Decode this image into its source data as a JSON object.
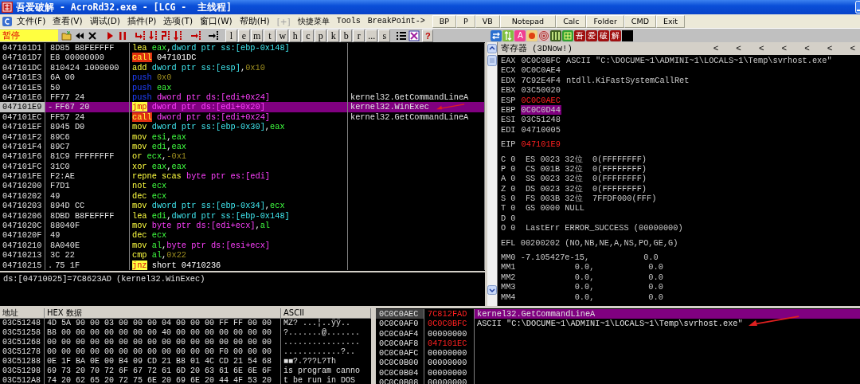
{
  "window": {
    "title": "吾爱破解 - AcroRd32.exe - [LCG -  主线程]"
  },
  "menu": {
    "items": [
      {
        "label": "文件(F)",
        "disabled": false
      },
      {
        "label": "查看(V)",
        "disabled": false
      },
      {
        "label": "调试(D)",
        "disabled": false
      },
      {
        "label": "插件(P)",
        "disabled": false
      },
      {
        "label": "选项(T)",
        "disabled": false
      },
      {
        "label": "窗口(W)",
        "disabled": false
      },
      {
        "label": "帮助(H)",
        "disabled": false
      },
      {
        "label": "[+]",
        "disabled": true
      },
      {
        "label": "快捷菜单",
        "disabled": false
      },
      {
        "label": "Tools",
        "disabled": false
      },
      {
        "label": "BreakPoint->",
        "disabled": false
      }
    ],
    "quick_buttons": [
      "BP",
      "P",
      "VB",
      "Notepad",
      "Calc",
      "Folder",
      "CMD",
      "Exit"
    ]
  },
  "toolbar": {
    "status": "暂停",
    "letter_buttons": [
      "l",
      "e",
      "m",
      "t",
      "w",
      "h",
      "c",
      "p",
      "k",
      "b",
      "r",
      "...",
      "s"
    ],
    "help_button": "?",
    "plugin_tools": [
      {
        "kind": "swap"
      },
      {
        "kind": "updown"
      },
      {
        "kind": "letter",
        "label": "A",
        "color": "#f04090"
      },
      {
        "kind": "record"
      },
      {
        "kind": "target"
      },
      {
        "kind": "bars"
      },
      {
        "kind": "window"
      },
      {
        "kind": "letter",
        "label": "吾",
        "color": "#a01010"
      },
      {
        "kind": "letter",
        "label": "爱",
        "color": "#a01010"
      },
      {
        "kind": "letter",
        "label": "破",
        "color": "#a01010"
      },
      {
        "kind": "letter",
        "label": "解",
        "color": "#a01010"
      },
      {
        "kind": "black"
      }
    ]
  },
  "disassembly": {
    "rows": [
      {
        "address": "047101D1",
        "marker": "",
        "hex": "8D85 B8FEFFFF",
        "mnemonic": "lea",
        "kind": "op",
        "ops": [
          {
            "kind": "reg",
            "text": "eax"
          },
          {
            "kind": "sep",
            "text": ","
          },
          {
            "kind": "stack",
            "text": "dword ptr ss:[ebp-0x148]"
          }
        ],
        "comment": "",
        "selected": false
      },
      {
        "address": "047101D7",
        "marker": "",
        "hex": "E8 00000000",
        "mnemonic": "call",
        "kind": "call",
        "ops": [
          {
            "kind": "plain",
            "text": "047101DC"
          }
        ],
        "comment": "",
        "selected": false
      },
      {
        "address": "047101DC",
        "marker": "",
        "hex": "810424 1000000",
        "mnemonic": "add",
        "kind": "op",
        "ops": [
          {
            "kind": "stack",
            "text": "dword ptr ss:[esp]"
          },
          {
            "kind": "sep",
            "text": ","
          },
          {
            "kind": "imm",
            "text": "0x10"
          }
        ],
        "comment": "",
        "selected": false
      },
      {
        "address": "047101E3",
        "marker": "",
        "hex": "6A 00",
        "mnemonic": "push",
        "kind": "push",
        "ops": [
          {
            "kind": "imm",
            "text": "0x0"
          }
        ],
        "comment": "",
        "selected": false
      },
      {
        "address": "047101E5",
        "marker": "",
        "hex": "50",
        "mnemonic": "push",
        "kind": "push",
        "ops": [
          {
            "kind": "reg",
            "text": "eax"
          }
        ],
        "comment": "",
        "selected": false
      },
      {
        "address": "047101E6",
        "marker": "",
        "hex": "FF77 24",
        "mnemonic": "push",
        "kind": "push",
        "ops": [
          {
            "kind": "mem",
            "text": "dword ptr ds:[edi+0x24]"
          }
        ],
        "comment": "kernel32.GetCommandLineA",
        "selected": false
      },
      {
        "address": "047101E9",
        "marker": "-",
        "hex": "FF67 20",
        "mnemonic": "jmp",
        "kind": "jump",
        "ops": [
          {
            "kind": "mem",
            "text": "dword ptr ds:[edi+0x20]"
          }
        ],
        "comment": "kernel32.WinExec",
        "selected": true
      },
      {
        "address": "047101EC",
        "marker": "",
        "hex": "FF57 24",
        "mnemonic": "call",
        "kind": "call",
        "ops": [
          {
            "kind": "mem",
            "text": "dword ptr ds:[edi+0x24]"
          }
        ],
        "comment": "kernel32.GetCommandLineA",
        "selected": false
      },
      {
        "address": "047101EF",
        "marker": "",
        "hex": "8945 D0",
        "mnemonic": "mov",
        "kind": "op",
        "ops": [
          {
            "kind": "stack",
            "text": "dword ptr ss:[ebp-0x30]"
          },
          {
            "kind": "sep",
            "text": ","
          },
          {
            "kind": "reg",
            "text": "eax"
          }
        ],
        "comment": "",
        "selected": false
      },
      {
        "address": "047101F2",
        "marker": "",
        "hex": "89C6",
        "mnemonic": "mov",
        "kind": "op",
        "ops": [
          {
            "kind": "reg",
            "text": "esi"
          },
          {
            "kind": "sep",
            "text": ","
          },
          {
            "kind": "reg",
            "text": "eax"
          }
        ],
        "comment": "",
        "selected": false
      },
      {
        "address": "047101F4",
        "marker": "",
        "hex": "89C7",
        "mnemonic": "mov",
        "kind": "op",
        "ops": [
          {
            "kind": "reg",
            "text": "edi"
          },
          {
            "kind": "sep",
            "text": ","
          },
          {
            "kind": "reg",
            "text": "eax"
          }
        ],
        "comment": "",
        "selected": false
      },
      {
        "address": "047101F6",
        "marker": "",
        "hex": "81C9 FFFFFFFF",
        "mnemonic": "or",
        "kind": "op",
        "ops": [
          {
            "kind": "reg",
            "text": "ecx"
          },
          {
            "kind": "sep",
            "text": ","
          },
          {
            "kind": "imm",
            "text": "-0x1"
          }
        ],
        "comment": "",
        "selected": false
      },
      {
        "address": "047101FC",
        "marker": "",
        "hex": "31C0",
        "mnemonic": "xor",
        "kind": "op",
        "ops": [
          {
            "kind": "reg",
            "text": "eax"
          },
          {
            "kind": "sep",
            "text": ","
          },
          {
            "kind": "reg",
            "text": "eax"
          }
        ],
        "comment": "",
        "selected": false
      },
      {
        "address": "047101FE",
        "marker": "",
        "hex": "F2:AE",
        "mnemonic": "repne scas",
        "kind": "op",
        "ops": [
          {
            "kind": "mem",
            "text": "byte ptr es:[edi]"
          }
        ],
        "comment": "",
        "selected": false
      },
      {
        "address": "04710200",
        "marker": "",
        "hex": "F7D1",
        "mnemonic": "not",
        "kind": "op",
        "ops": [
          {
            "kind": "reg",
            "text": "ecx"
          }
        ],
        "comment": "",
        "selected": false
      },
      {
        "address": "04710202",
        "marker": "",
        "hex": "49",
        "mnemonic": "dec",
        "kind": "op",
        "ops": [
          {
            "kind": "reg",
            "text": "ecx"
          }
        ],
        "comment": "",
        "selected": false
      },
      {
        "address": "04710203",
        "marker": "",
        "hex": "894D CC",
        "mnemonic": "mov",
        "kind": "op",
        "ops": [
          {
            "kind": "stack",
            "text": "dword ptr ss:[ebp-0x34]"
          },
          {
            "kind": "sep",
            "text": ","
          },
          {
            "kind": "reg",
            "text": "ecx"
          }
        ],
        "comment": "",
        "selected": false
      },
      {
        "address": "04710206",
        "marker": "",
        "hex": "8DBD B8FEFFFF",
        "mnemonic": "lea",
        "kind": "op",
        "ops": [
          {
            "kind": "reg",
            "text": "edi"
          },
          {
            "kind": "sep",
            "text": ","
          },
          {
            "kind": "stack",
            "text": "dword ptr ss:[ebp-0x148]"
          }
        ],
        "comment": "",
        "selected": false
      },
      {
        "address": "0471020C",
        "marker": "",
        "hex": "88040F",
        "mnemonic": "mov",
        "kind": "op",
        "ops": [
          {
            "kind": "mem",
            "text": "byte ptr ds:[edi+ecx]"
          },
          {
            "kind": "sep",
            "text": ","
          },
          {
            "kind": "reg",
            "text": "al"
          }
        ],
        "comment": "",
        "selected": false
      },
      {
        "address": "0471020F",
        "marker": "",
        "hex": "49",
        "mnemonic": "dec",
        "kind": "op",
        "ops": [
          {
            "kind": "reg",
            "text": "ecx"
          }
        ],
        "comment": "",
        "selected": false
      },
      {
        "address": "04710210",
        "marker": "",
        "hex": "8A040E",
        "mnemonic": "mov",
        "kind": "op",
        "ops": [
          {
            "kind": "reg",
            "text": "al"
          },
          {
            "kind": "sep",
            "text": ","
          },
          {
            "kind": "mem",
            "text": "byte ptr ds:[esi+ecx]"
          }
        ],
        "comment": "",
        "selected": false
      },
      {
        "address": "04710213",
        "marker": "",
        "hex": "3C 22",
        "mnemonic": "cmp",
        "kind": "op",
        "ops": [
          {
            "kind": "reg",
            "text": "al"
          },
          {
            "kind": "sep",
            "text": ","
          },
          {
            "kind": "imm",
            "text": "0x22"
          }
        ],
        "comment": "",
        "selected": false
      },
      {
        "address": "04710215",
        "marker": ".",
        "hex": "75 1F",
        "mnemonic": "jnz",
        "kind": "jump",
        "ops": [
          {
            "kind": "plain",
            "text": "short 04710236"
          }
        ],
        "comment": "",
        "selected": false
      }
    ],
    "info": "ds:[04710025]=7C8623AD (kernel32.WinExec)"
  },
  "registers": {
    "title": "寄存器 (3DNow!)",
    "arrows": [
      "<",
      "<",
      "<",
      "<",
      "<",
      "<",
      "<"
    ],
    "rows": [
      {
        "name": "EAX",
        "value": "0C0C0BFC",
        "comment": "ASCII \"C:\\DOCUME~1\\ADMINI~1\\LOCALS~1\\Temp\\svrhost.exe\"",
        "changed": false,
        "selected": false
      },
      {
        "name": "ECX",
        "value": "0C0C0AE4",
        "comment": "",
        "changed": false,
        "selected": false
      },
      {
        "name": "EDX",
        "value": "7C92E4F4",
        "comment": "ntdll.KiFastSystemCallRet",
        "changed": false,
        "selected": false
      },
      {
        "name": "EBX",
        "value": "03C50020",
        "comment": "",
        "changed": false,
        "selected": false
      },
      {
        "name": "ESP",
        "value": "0C0C0AEC",
        "comment": "",
        "changed": true,
        "selected": false
      },
      {
        "name": "EBP",
        "value": "0C0C0D44",
        "comment": "",
        "changed": false,
        "selected": true
      },
      {
        "name": "ESI",
        "value": "03C51248",
        "comment": "",
        "changed": false,
        "selected": false
      },
      {
        "name": "EDI",
        "value": "04710005",
        "comment": "",
        "changed": false,
        "selected": false
      }
    ],
    "eip": {
      "name": "EIP",
      "value": "047101E9",
      "changed": true
    },
    "flags": [
      "C 0  ES 0023 32位  0(FFFFFFFF)",
      "P 0  CS 001B 32位  0(FFFFFFFF)",
      "A 0  SS 0023 32位  0(FFFFFFFF)",
      "Z 0  DS 0023 32位  0(FFFFFFFF)",
      "S 0  FS 003B 32位  7FFDF000(FFF)",
      "T 0  GS 0000 NULL",
      "D 0",
      "O 0  LastErr ERROR_SUCCESS (00000000)"
    ],
    "efl": "EFL 00200202 (NO,NB,NE,A,NS,PO,GE,G)",
    "mmx": [
      "MM0 -7.105427e-15,           0.0",
      "MM1            0.0,           0.0",
      "MM2            0.0,           0.0",
      "MM3            0.0,           0.0",
      "MM4            0.0,           0.0"
    ]
  },
  "dump": {
    "columns": [
      "地址",
      "HEX 数据",
      "ASCII"
    ],
    "rows": [
      {
        "address": "03C51248",
        "hex": "4D 5A 90 00 03 00 00 00 04 00 00 00 FF FF 00 00",
        "ascii": "MZ?‾...¦..ÿÿ.."
      },
      {
        "address": "03C51258",
        "hex": "B8 00 00 00 00 00 00 00 40 00 00 00 00 00 00 00",
        "ascii": "?.......@......."
      },
      {
        "address": "03C51268",
        "hex": "00 00 00 00 00 00 00 00 00 00 00 00 00 00 00 00",
        "ascii": "................"
      },
      {
        "address": "03C51278",
        "hex": "00 00 00 00 00 00 00 00 00 00 00 00 F0 00 00 00",
        "ascii": "............?.."
      },
      {
        "address": "03C51288",
        "hex": "0E 1F BA 0E 00 B4 09 CD 21 B8 01 4C CD 21 54 68",
        "ascii": "■■?.???L?Th"
      },
      {
        "address": "03C51298",
        "hex": "69 73 20 70 72 6F 67 72 61 6D 20 63 61 6E 6E 6F",
        "ascii": "is program canno"
      },
      {
        "address": "03C512A8",
        "hex": "74 20 62 65 20 72 75 6E 20 69 6E 20 44 4F 53 20",
        "ascii": "t be run in DOS"
      }
    ]
  },
  "stack": {
    "rows": [
      {
        "address": "0C0C0AEC",
        "value": "7C812FAD",
        "comment": "kernel32.GetCommandLineA",
        "changed": true,
        "selected": true
      },
      {
        "address": "0C0C0AF0",
        "value": "0C0C0BFC",
        "comment": "ASCII \"C:\\DOCUME~1\\ADMINI~1\\LOCALS~1\\Temp\\svrhost.exe\"",
        "changed": true,
        "selected": false
      },
      {
        "address": "0C0C0AF4",
        "value": "00000000",
        "comment": "",
        "changed": false,
        "selected": false
      },
      {
        "address": "0C0C0AF8",
        "value": "047101EC",
        "comment": "",
        "changed": true,
        "selected": false
      },
      {
        "address": "0C0C0AFC",
        "value": "00000000",
        "comment": "",
        "changed": false,
        "selected": false
      },
      {
        "address": "0C0C0B00",
        "value": "00000000",
        "comment": "",
        "changed": false,
        "selected": false
      },
      {
        "address": "0C0C0B04",
        "value": "00000000",
        "comment": "",
        "changed": false,
        "selected": false
      },
      {
        "address": "0C0C0B08",
        "value": "00000000",
        "comment": "",
        "changed": false,
        "selected": false
      }
    ]
  }
}
